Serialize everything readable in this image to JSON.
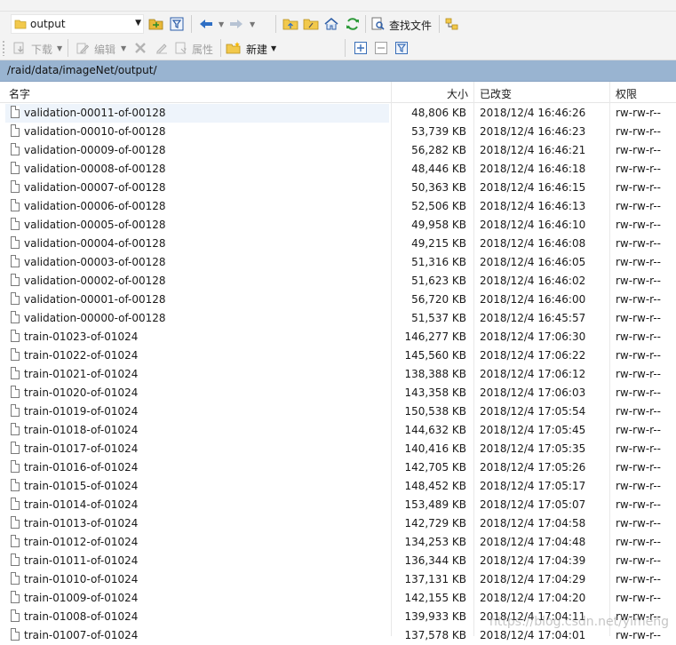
{
  "toolbar1": {
    "location_value": "output",
    "find_files_label": "查找文件"
  },
  "toolbar2": {
    "download_label": "下载",
    "edit_label": "编辑",
    "properties_label": "属性",
    "new_label": "新建"
  },
  "path": "/raid/data/imageNet/output/",
  "columns": {
    "name": "名字",
    "size": "大小",
    "modified": "已改变",
    "permissions": "权限"
  },
  "selected_row": 0,
  "files": [
    {
      "name": "validation-00011-of-00128",
      "size": "48,806 KB",
      "modified": "2018/12/4 16:46:26",
      "perms": "rw-rw-r--"
    },
    {
      "name": "validation-00010-of-00128",
      "size": "53,739 KB",
      "modified": "2018/12/4 16:46:23",
      "perms": "rw-rw-r--"
    },
    {
      "name": "validation-00009-of-00128",
      "size": "56,282 KB",
      "modified": "2018/12/4 16:46:21",
      "perms": "rw-rw-r--"
    },
    {
      "name": "validation-00008-of-00128",
      "size": "48,446 KB",
      "modified": "2018/12/4 16:46:18",
      "perms": "rw-rw-r--"
    },
    {
      "name": "validation-00007-of-00128",
      "size": "50,363 KB",
      "modified": "2018/12/4 16:46:15",
      "perms": "rw-rw-r--"
    },
    {
      "name": "validation-00006-of-00128",
      "size": "52,506 KB",
      "modified": "2018/12/4 16:46:13",
      "perms": "rw-rw-r--"
    },
    {
      "name": "validation-00005-of-00128",
      "size": "49,958 KB",
      "modified": "2018/12/4 16:46:10",
      "perms": "rw-rw-r--"
    },
    {
      "name": "validation-00004-of-00128",
      "size": "49,215 KB",
      "modified": "2018/12/4 16:46:08",
      "perms": "rw-rw-r--"
    },
    {
      "name": "validation-00003-of-00128",
      "size": "51,316 KB",
      "modified": "2018/12/4 16:46:05",
      "perms": "rw-rw-r--"
    },
    {
      "name": "validation-00002-of-00128",
      "size": "51,623 KB",
      "modified": "2018/12/4 16:46:02",
      "perms": "rw-rw-r--"
    },
    {
      "name": "validation-00001-of-00128",
      "size": "56,720 KB",
      "modified": "2018/12/4 16:46:00",
      "perms": "rw-rw-r--"
    },
    {
      "name": "validation-00000-of-00128",
      "size": "51,537 KB",
      "modified": "2018/12/4 16:45:57",
      "perms": "rw-rw-r--"
    },
    {
      "name": "train-01023-of-01024",
      "size": "146,277 KB",
      "modified": "2018/12/4 17:06:30",
      "perms": "rw-rw-r--"
    },
    {
      "name": "train-01022-of-01024",
      "size": "145,560 KB",
      "modified": "2018/12/4 17:06:22",
      "perms": "rw-rw-r--"
    },
    {
      "name": "train-01021-of-01024",
      "size": "138,388 KB",
      "modified": "2018/12/4 17:06:12",
      "perms": "rw-rw-r--"
    },
    {
      "name": "train-01020-of-01024",
      "size": "143,358 KB",
      "modified": "2018/12/4 17:06:03",
      "perms": "rw-rw-r--"
    },
    {
      "name": "train-01019-of-01024",
      "size": "150,538 KB",
      "modified": "2018/12/4 17:05:54",
      "perms": "rw-rw-r--"
    },
    {
      "name": "train-01018-of-01024",
      "size": "144,632 KB",
      "modified": "2018/12/4 17:05:45",
      "perms": "rw-rw-r--"
    },
    {
      "name": "train-01017-of-01024",
      "size": "140,416 KB",
      "modified": "2018/12/4 17:05:35",
      "perms": "rw-rw-r--"
    },
    {
      "name": "train-01016-of-01024",
      "size": "142,705 KB",
      "modified": "2018/12/4 17:05:26",
      "perms": "rw-rw-r--"
    },
    {
      "name": "train-01015-of-01024",
      "size": "148,452 KB",
      "modified": "2018/12/4 17:05:17",
      "perms": "rw-rw-r--"
    },
    {
      "name": "train-01014-of-01024",
      "size": "153,489 KB",
      "modified": "2018/12/4 17:05:07",
      "perms": "rw-rw-r--"
    },
    {
      "name": "train-01013-of-01024",
      "size": "142,729 KB",
      "modified": "2018/12/4 17:04:58",
      "perms": "rw-rw-r--"
    },
    {
      "name": "train-01012-of-01024",
      "size": "134,253 KB",
      "modified": "2018/12/4 17:04:48",
      "perms": "rw-rw-r--"
    },
    {
      "name": "train-01011-of-01024",
      "size": "136,344 KB",
      "modified": "2018/12/4 17:04:39",
      "perms": "rw-rw-r--"
    },
    {
      "name": "train-01010-of-01024",
      "size": "137,131 KB",
      "modified": "2018/12/4 17:04:29",
      "perms": "rw-rw-r--"
    },
    {
      "name": "train-01009-of-01024",
      "size": "142,155 KB",
      "modified": "2018/12/4 17:04:20",
      "perms": "rw-rw-r--"
    },
    {
      "name": "train-01008-of-01024",
      "size": "139,933 KB",
      "modified": "2018/12/4 17:04:11",
      "perms": "rw-rw-r--"
    },
    {
      "name": "train-01007-of-01024",
      "size": "137,578 KB",
      "modified": "2018/12/4 17:04:01",
      "perms": "rw-rw-r--"
    }
  ],
  "watermark": "https://blog.csdn.net/yimeng"
}
